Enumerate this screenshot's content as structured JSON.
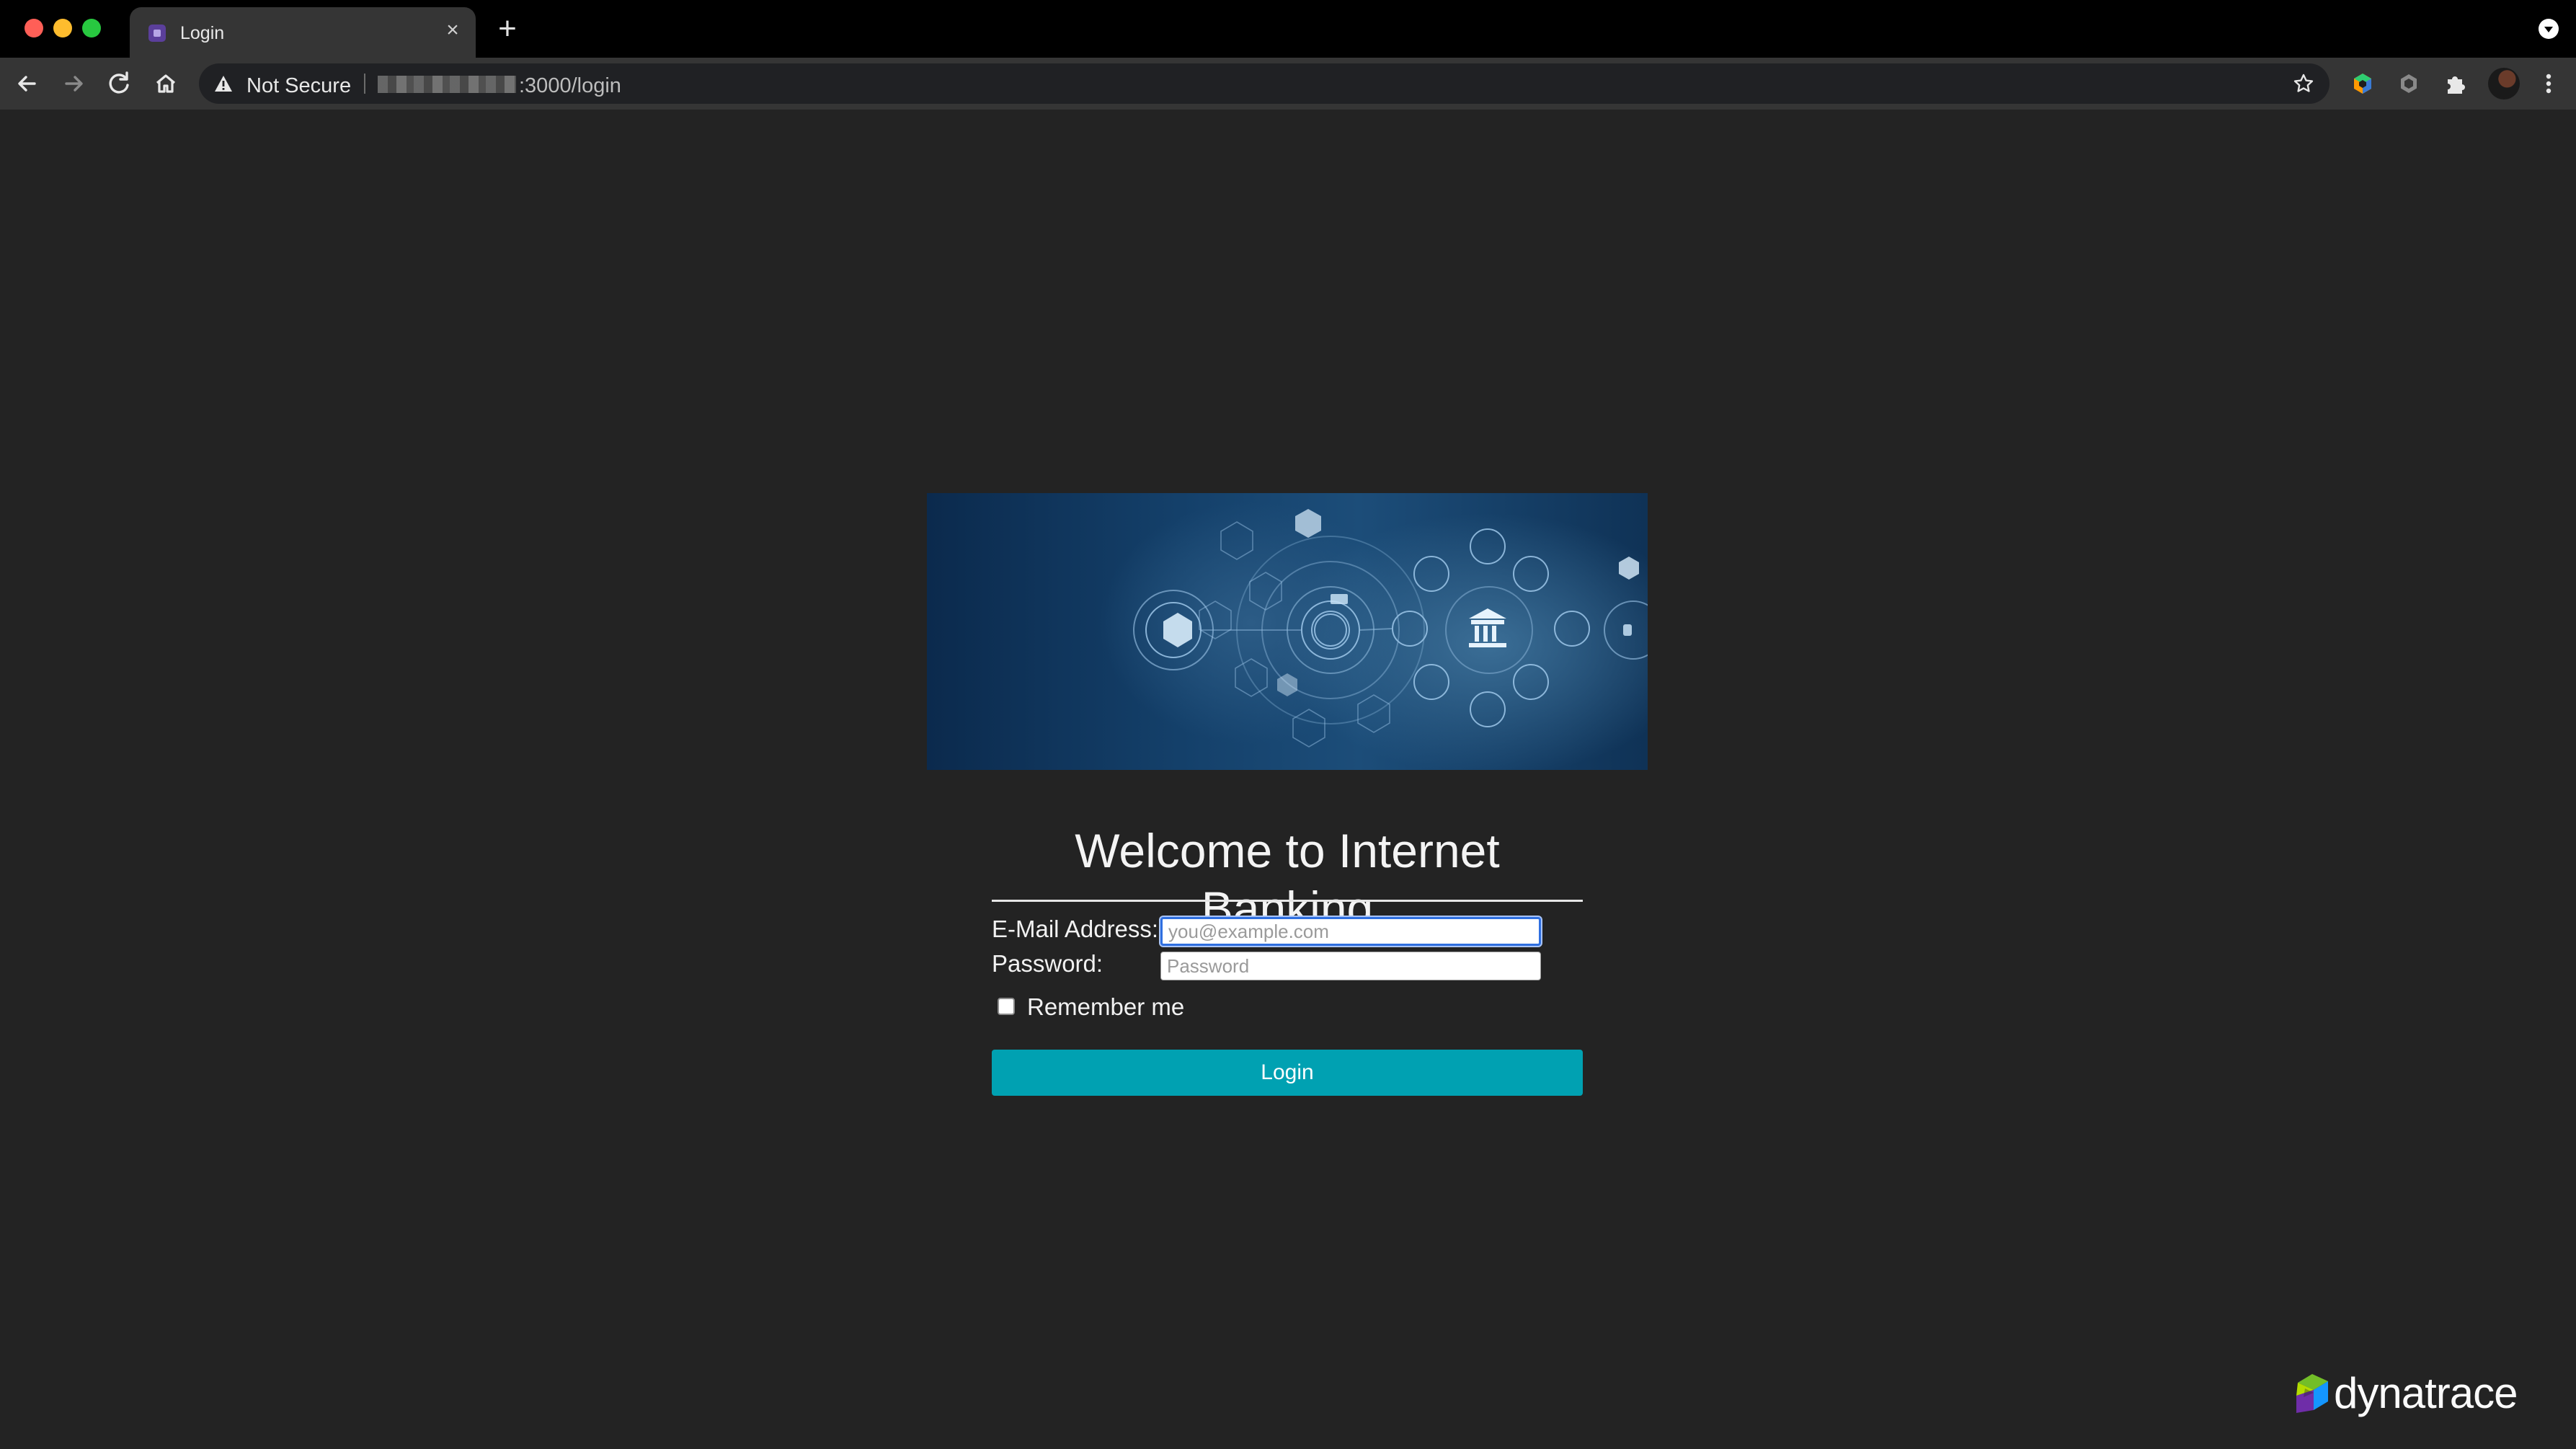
{
  "browser": {
    "tab": {
      "title": "Login"
    },
    "address_bar": {
      "security_label": "Not Secure",
      "url_visible": ":3000/login"
    }
  },
  "page": {
    "heading": "Welcome to Internet Banking",
    "form": {
      "email_label": "E-Mail Address:",
      "email_placeholder": "you@example.com",
      "email_value": "",
      "password_label": "Password:",
      "password_placeholder": "Password",
      "password_value": "",
      "remember_label": "Remember me",
      "remember_checked": false,
      "submit_label": "Login"
    },
    "footer_logo": {
      "wordmark": "dynatrace"
    }
  },
  "colors": {
    "page_background": "#232323",
    "login_button": "#00a1b2",
    "focus_ring": "#2f6fe0"
  },
  "icons": [
    "back-icon",
    "forward-icon",
    "reload-icon",
    "home-icon",
    "warning-icon",
    "bookmark-star-icon",
    "extension-icon",
    "puzzle-icon",
    "menu-icon"
  ]
}
